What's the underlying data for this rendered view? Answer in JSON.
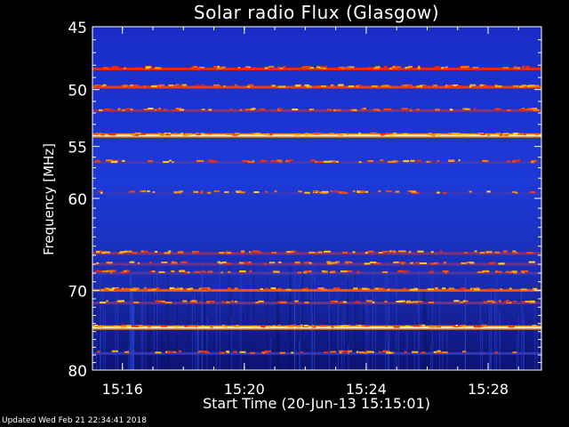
{
  "chart_data": {
    "type": "heatmap",
    "title": "Solar radio Flux (Glasgow)",
    "xlabel": "Start Time (20-Jun-13 15:15:01)",
    "ylabel": "Frequency [MHz]",
    "x_start": "15:15:01",
    "x_end": "15:29:45",
    "xticks": [
      "15:16",
      "15:20",
      "15:24",
      "15:28"
    ],
    "yticks": [
      45,
      50,
      55,
      60,
      70,
      80
    ],
    "ylim": [
      45,
      80
    ],
    "y_scale": "log",
    "colormap": "blue-red-yellow-white",
    "bands": [
      {
        "freq": 48.3,
        "intensity": 0.78
      },
      {
        "freq": 49.8,
        "intensity": 0.85
      },
      {
        "freq": 51.8,
        "intensity": 0.6
      },
      {
        "freq": 54.0,
        "intensity": 0.98
      },
      {
        "freq": 56.5,
        "intensity": 0.5
      },
      {
        "freq": 59.5,
        "intensity": 0.45
      },
      {
        "freq": 65.8,
        "intensity": 0.6
      },
      {
        "freq": 67.0,
        "intensity": 0.55
      },
      {
        "freq": 68.0,
        "intensity": 0.5
      },
      {
        "freq": 70.0,
        "intensity": 0.9
      },
      {
        "freq": 71.5,
        "intensity": 0.55
      },
      {
        "freq": 74.5,
        "intensity": 1.0
      },
      {
        "freq": 77.8,
        "intensity": 0.45
      }
    ]
  },
  "footer": "Updated Wed Feb 21 22:34:41 2018",
  "colors": {
    "background": "#000000",
    "low": "#0a0a78",
    "mid": "#1c3cd8",
    "high": "#ff2a00",
    "peak": "#fff4c8"
  }
}
